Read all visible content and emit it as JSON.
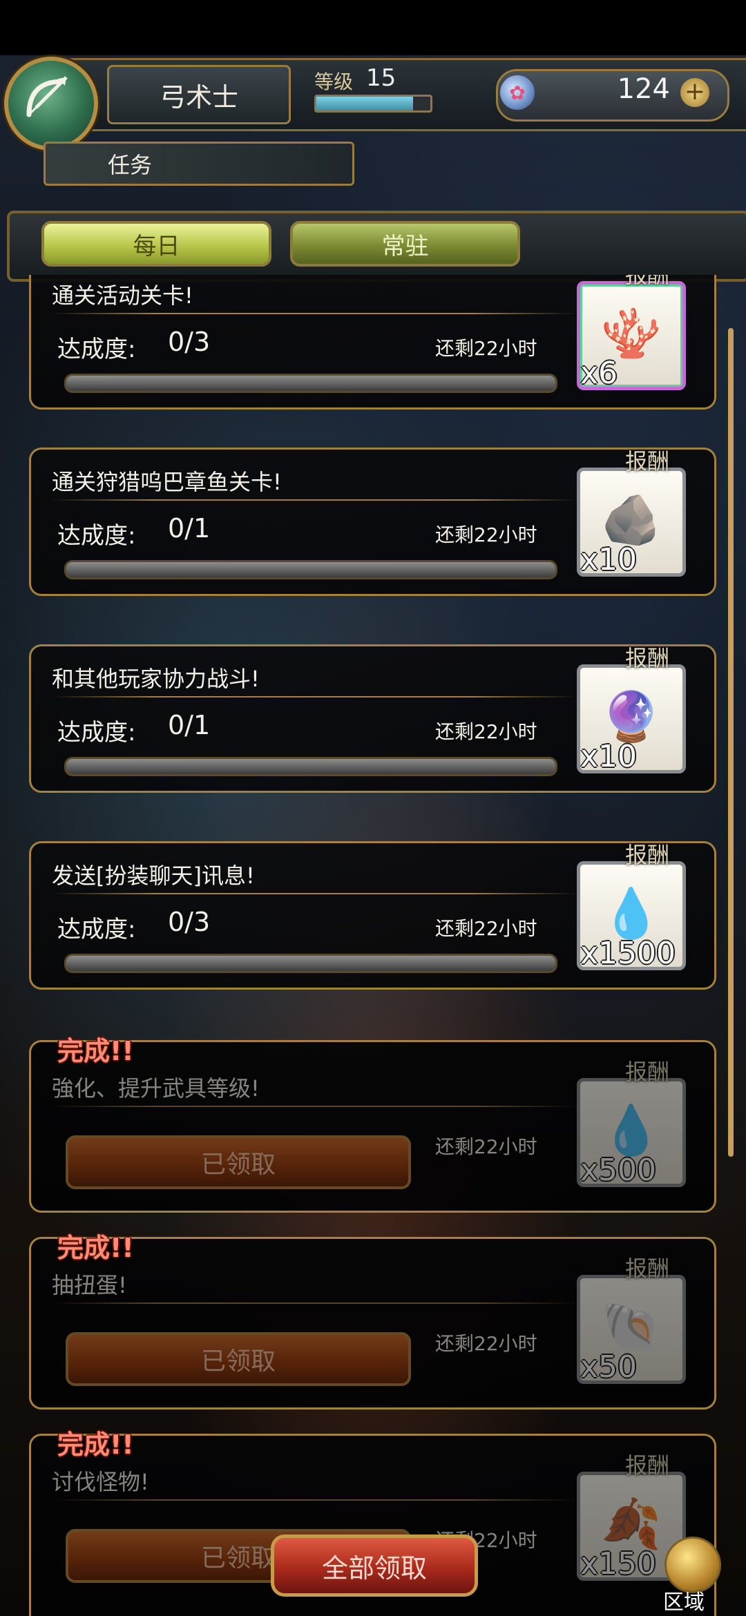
{
  "header": {
    "class_name": "弓术士",
    "level_label": "等级",
    "level_value": "15",
    "xp_progress": 0.85,
    "currency_icon": "coral-gem-icon",
    "currency_count": "124",
    "plus_label": "+"
  },
  "section_title": "任务",
  "tabs": [
    {
      "label": "每日",
      "active": true
    },
    {
      "label": "常驻",
      "active": false
    }
  ],
  "reward_label": "报酬",
  "progress_label": "达成度:",
  "done_flag": "完成!!",
  "quests": [
    {
      "title": "通关活动关卡!",
      "progress": "0/3",
      "time_left": "还剩22小时",
      "reward_icon": "coral-crystal-icon",
      "reward_qty": "x6",
      "status": "in_progress"
    },
    {
      "title": "通关狩猎呜巴章鱼关卡!",
      "progress": "0/1",
      "time_left": "还剩22小时",
      "reward_icon": "ore-chunk-icon",
      "reward_qty": "x10",
      "status": "in_progress"
    },
    {
      "title": "和其他玩家协力战斗!",
      "progress": "0/1",
      "time_left": "还剩22小时",
      "reward_icon": "dark-orb-icon",
      "reward_qty": "x10",
      "status": "in_progress"
    },
    {
      "title": "发送[扮装聊天]讯息!",
      "progress": "0/3",
      "time_left": "还剩22小时",
      "reward_icon": "blue-pouch-icon",
      "reward_qty": "x1500",
      "status": "in_progress"
    },
    {
      "title": "強化、提升武具等级!",
      "time_left": "还剩22小时",
      "reward_icon": "blue-pouch-icon",
      "reward_qty": "x500",
      "status": "done",
      "button_label": "已领取"
    },
    {
      "title": "抽扭蛋!",
      "time_left": "还剩22小时",
      "reward_icon": "pearl-shell-icon",
      "reward_qty": "x50",
      "status": "done",
      "button_label": "已领取"
    },
    {
      "title": "讨伐怪物!",
      "time_left": "还剩22小时",
      "reward_icon": "red-pouch-icon",
      "reward_qty": "x150",
      "status": "done",
      "button_label": "已领取"
    }
  ],
  "claim_all_label": "全部领取",
  "region_label": "区域"
}
